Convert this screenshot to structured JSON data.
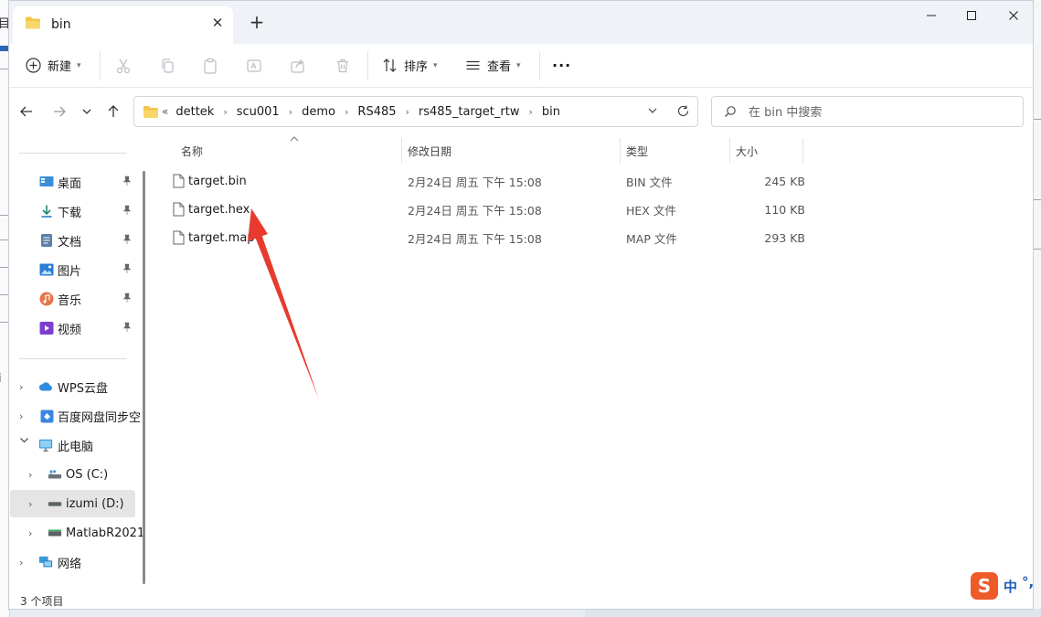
{
  "window": {
    "tab_title": "bin",
    "tab_close": "✕",
    "new_tab": "+"
  },
  "background": {
    "left_glyph_1": "目",
    "left_glyph_2": "i"
  },
  "toolbar": {
    "new_label": "新建",
    "sort_label": "排序",
    "view_label": "查看",
    "more": "···"
  },
  "address": {
    "more": "«",
    "crumbs": [
      "dettek",
      "scu001",
      "demo",
      "RS485",
      "rs485_target_rtw",
      "bin"
    ],
    "separator": "›"
  },
  "search": {
    "placeholder": "在 bin 中搜索"
  },
  "nav": {
    "quick_access": [
      {
        "label": "桌面",
        "icon": "desktop-icon"
      },
      {
        "label": "下载",
        "icon": "download-icon"
      },
      {
        "label": "文档",
        "icon": "document-icon"
      },
      {
        "label": "图片",
        "icon": "picture-icon"
      },
      {
        "label": "音乐",
        "icon": "music-icon"
      },
      {
        "label": "视频",
        "icon": "video-icon"
      }
    ],
    "tree": [
      {
        "label": "WPS云盘",
        "icon": "cloud-icon"
      },
      {
        "label": "百度网盘同步空",
        "icon": "baidu-sync-icon"
      },
      {
        "label": "此电脑",
        "icon": "computer-icon"
      },
      {
        "label": "OS (C:)",
        "icon": "drive-icon"
      },
      {
        "label": "izumi (D:)",
        "icon": "drive-icon"
      },
      {
        "label": "MatlabR2021",
        "icon": "drive-icon"
      },
      {
        "label": "网络",
        "icon": "network-icon"
      }
    ],
    "pin_glyph": "📌",
    "chevron_right": "›",
    "chevron_down": "⌄"
  },
  "filelist": {
    "columns": {
      "name": "名称",
      "modified": "修改日期",
      "type": "类型",
      "size": "大小"
    },
    "sort_glyph": "^",
    "files": [
      {
        "name": "target.bin",
        "modified": "2月24日 周五 下午 15:08",
        "type": "BIN 文件",
        "size": "245 KB"
      },
      {
        "name": "target.hex",
        "modified": "2月24日 周五 下午 15:08",
        "type": "HEX 文件",
        "size": "110 KB"
      },
      {
        "name": "target.map",
        "modified": "2月24日 周五 下午 15:08",
        "type": "MAP 文件",
        "size": "293 KB"
      }
    ]
  },
  "status": {
    "item_count": "3 个项目"
  },
  "ime": {
    "logo": "S",
    "mode": "中",
    "punct": "°,"
  },
  "colors": {
    "accent_red": "#e83a2e",
    "folder_yellow": "#f3c54a",
    "ime_orange": "#ef5a2a"
  }
}
